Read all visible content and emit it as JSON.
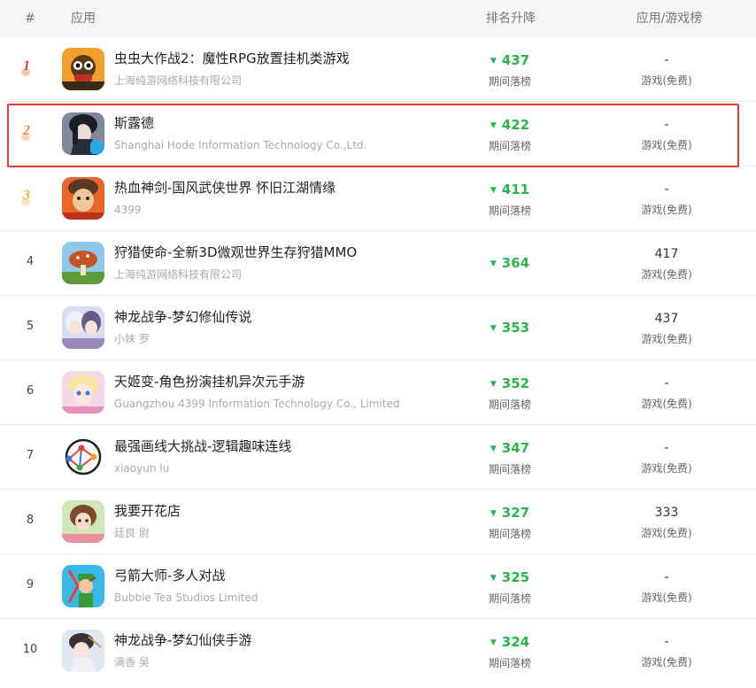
{
  "header": {
    "num": "#",
    "app": "应用",
    "rank_change": "排名升降",
    "category": "应用/游戏榜"
  },
  "colors": {
    "up_green": "#2bb34c",
    "highlight_red": "#e33a3a",
    "medal_gold": "#e8b32a",
    "medal_red": "#e8403a",
    "medal_orange": "#ec8a3a"
  },
  "rows": [
    {
      "rank": "1",
      "name": "虫虫大作战2：魔性RPG放置挂机类游戏",
      "developer": "上海纯游网络科技有限公司",
      "change": "437",
      "change_label": "期间落榜",
      "cat_rank": "-",
      "cat_label": "游戏(免费)",
      "icon": "bug-warrior-icon"
    },
    {
      "rank": "2",
      "name": "斯露德",
      "developer": "Shanghai Hode Information Technology Co.,Ltd.",
      "change": "422",
      "change_label": "期间落榜",
      "cat_rank": "-",
      "cat_label": "游戏(免费)",
      "icon": "dark-hair-character-icon"
    },
    {
      "rank": "3",
      "name": "热血神剑-国风武侠世界 怀旧江湖情缘",
      "developer": "4399",
      "change": "411",
      "change_label": "期间落榜",
      "cat_rank": "-",
      "cat_label": "游戏(免费)",
      "icon": "warrior-face-icon"
    },
    {
      "rank": "4",
      "name": "狩猎使命-全新3D微观世界生存狩猎MMO",
      "developer": "上海纯游网络科技有限公司",
      "change": "364",
      "change_label": "",
      "cat_rank": "417",
      "cat_label": "游戏(免费)",
      "icon": "mushroom-landscape-icon"
    },
    {
      "rank": "5",
      "name": "神龙战争-梦幻修仙传说",
      "developer": "小妹 罗",
      "change": "353",
      "change_label": "",
      "cat_rank": "437",
      "cat_label": "游戏(免费)",
      "icon": "anime-girls-icon"
    },
    {
      "rank": "6",
      "name": "天姬变-角色扮演挂机异次元手游",
      "developer": "Guangzhou 4399 Information Technology Co., Limited",
      "change": "352",
      "change_label": "期间落榜",
      "cat_rank": "-",
      "cat_label": "游戏(免费)",
      "icon": "anime-princess-icon"
    },
    {
      "rank": "7",
      "name": "最强画线大挑战-逻辑趣味连线",
      "developer": "xiaoyun lu",
      "change": "347",
      "change_label": "期间落榜",
      "cat_rank": "-",
      "cat_label": "游戏(免费)",
      "icon": "line-puzzle-icon"
    },
    {
      "rank": "8",
      "name": "我要开花店",
      "developer": "廷良 尉",
      "change": "327",
      "change_label": "期间落榜",
      "cat_rank": "333",
      "cat_label": "游戏(免费)",
      "icon": "florist-girl-icon"
    },
    {
      "rank": "9",
      "name": "弓箭大师-多人对战",
      "developer": "Bubble Tea Studios Limited",
      "change": "325",
      "change_label": "期间落榜",
      "cat_rank": "-",
      "cat_label": "游戏(免费)",
      "icon": "archer-icon"
    },
    {
      "rank": "10",
      "name": "神龙战争-梦幻仙侠手游",
      "developer": "满香 吴",
      "change": "324",
      "change_label": "期间落榜",
      "cat_rank": "-",
      "cat_label": "游戏(免费)",
      "icon": "fairy-maiden-icon"
    }
  ]
}
